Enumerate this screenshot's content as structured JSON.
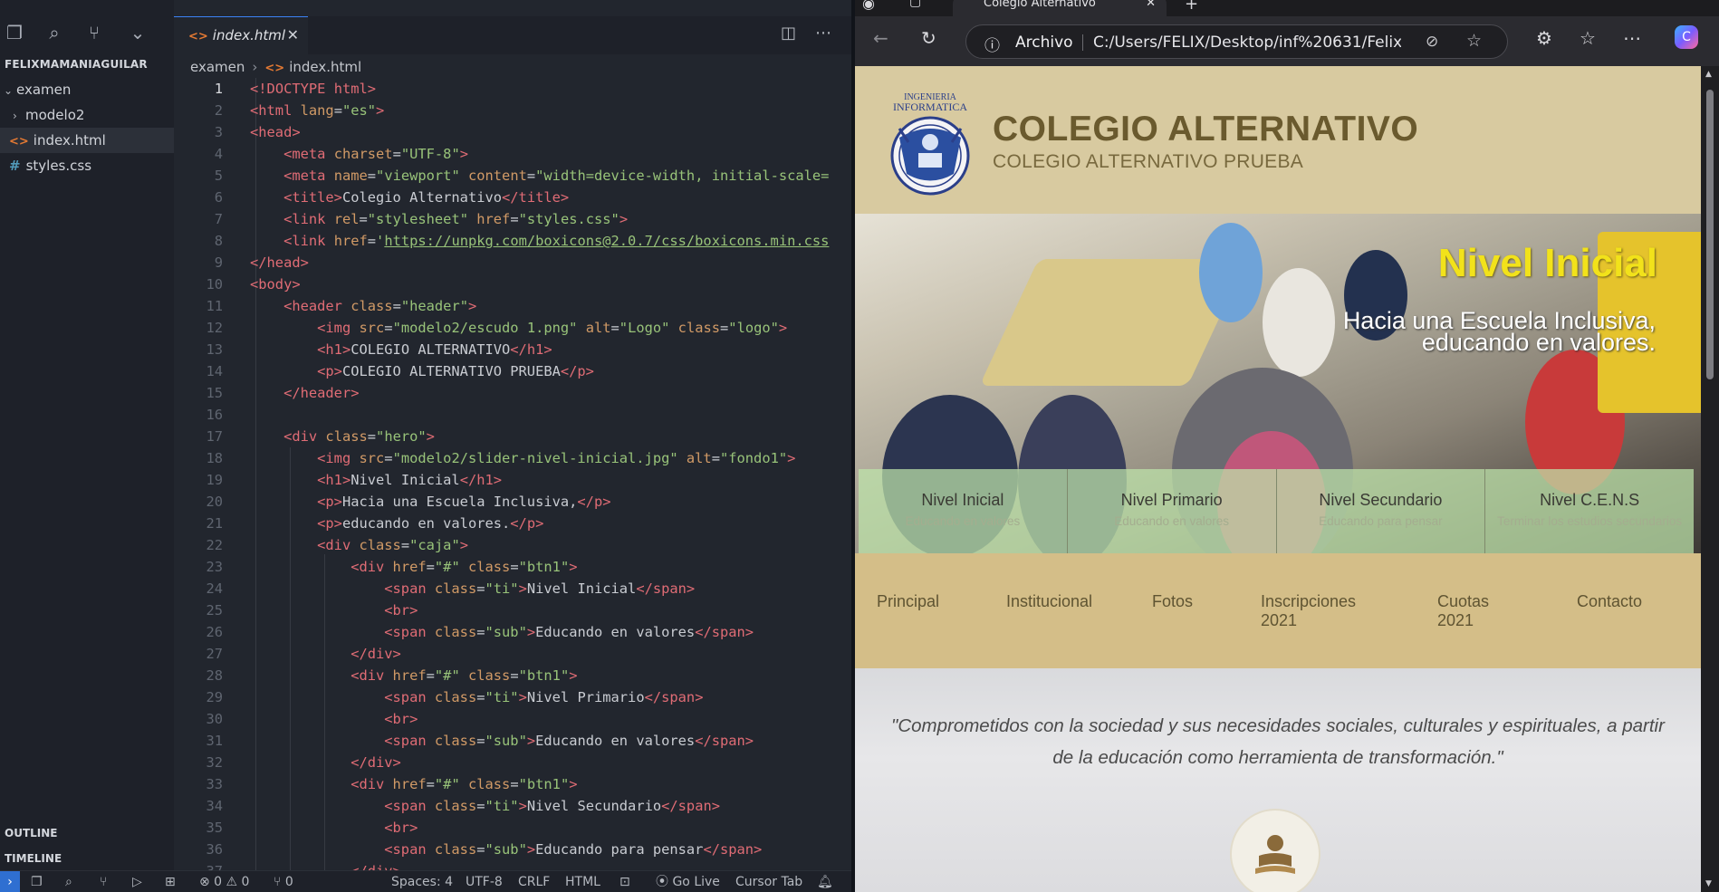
{
  "vscode": {
    "explorer": {
      "title": "FELIXMAMANIAGUILAR",
      "items": [
        {
          "label": "examen"
        },
        {
          "label": "modelo2"
        },
        {
          "label": "index.html"
        },
        {
          "label": "styles.css"
        }
      ],
      "outline_label": "OUTLINE",
      "timeline_label": "TIMELINE"
    },
    "tab": {
      "label": "index.html",
      "close": "✕"
    },
    "breadcrumb": {
      "folder": "examen",
      "file": "index.html"
    },
    "code_lines": [
      "1",
      "2",
      "3",
      "4",
      "5",
      "6",
      "7",
      "8",
      "9",
      "10",
      "11",
      "12",
      "13",
      "14",
      "15",
      "16",
      "17",
      "18",
      "19",
      "20",
      "21",
      "22",
      "23",
      "24",
      "25",
      "26",
      "27",
      "28",
      "29",
      "30",
      "31",
      "32",
      "33",
      "34",
      "35",
      "36",
      "37"
    ],
    "code": {
      "l1a": "<!",
      "l1b": "DOCTYPE",
      "l1c": " html",
      "l1d": ">",
      "l2a": "<html ",
      "l2b": "lang",
      "l2c": "=",
      "l2d": "\"es\"",
      "l2e": ">",
      "l3": "<head>",
      "l4a": "<meta ",
      "l4b": "charset",
      "l4c": "=",
      "l4d": "\"UTF-8\"",
      "l4e": ">",
      "l5a": "<meta ",
      "l5b": "name",
      "l5c": "=",
      "l5d": "\"viewport\"",
      "l5e": " content",
      "l5f": "=",
      "l5g": "\"width=device-width, initial-scale=",
      "l6a": "<title>",
      "l6b": "Colegio Alternativo",
      "l6c": "</title>",
      "l7a": "<link ",
      "l7b": "rel",
      "l7c": "=",
      "l7d": "\"stylesheet\"",
      "l7e": " href",
      "l7f": "=",
      "l7g": "\"styles.css\"",
      "l7h": ">",
      "l8a": "<link ",
      "l8b": "href",
      "l8c": "=",
      "l8d": "'",
      "l8e": "https://unpkg.com/boxicons@2.0.7/css/boxicons.min.css",
      "l9": "</head>",
      "l10": "<body>",
      "l11a": "<header ",
      "l11b": "class",
      "l11c": "=",
      "l11d": "\"header\"",
      "l11e": ">",
      "l12a": "<img ",
      "l12b": "src",
      "l12c": "=",
      "l12d": "\"modelo2/escudo 1.png\"",
      "l12e": " alt",
      "l12f": "=",
      "l12g": "\"Logo\"",
      "l12h": " class",
      "l12i": "=",
      "l12j": "\"logo\"",
      "l12k": ">",
      "l13a": "<h1>",
      "l13b": "COLEGIO ALTERNATIVO",
      "l13c": "</h1>",
      "l14a": "<p>",
      "l14b": "COLEGIO ALTERNATIVO PRUEBA",
      "l14c": "</p>",
      "l15": "</header>",
      "l17a": "<div ",
      "l17b": "class",
      "l17c": "=",
      "l17d": "\"hero\"",
      "l17e": ">",
      "l18a": "<img ",
      "l18b": "src",
      "l18c": "=",
      "l18d": "\"modelo2/slider-nivel-inicial.jpg\"",
      "l18e": " alt",
      "l18f": "=",
      "l18g": "\"fondo1\"",
      "l18h": ">",
      "l19a": "<h1>",
      "l19b": "Nivel Inicial",
      "l19c": "</h1>",
      "l20a": "<p>",
      "l20b": "Hacia una Escuela Inclusiva,",
      "l20c": "</p>",
      "l21a": "<p>",
      "l21b": "educando en valores.",
      "l21c": "</p>",
      "l22a": "<div ",
      "l22b": "class",
      "l22c": "=",
      "l22d": "\"caja\"",
      "l22e": ">",
      "div_btn_a": "<div ",
      "div_btn_b": "href",
      "div_btn_c": "=",
      "div_btn_d": "\"#\"",
      "div_btn_e": " class",
      "div_btn_f": "=",
      "div_btn_g": "\"btn1\"",
      "div_btn_h": ">",
      "span_a": "<span ",
      "span_b": "class",
      "span_c": "=",
      "span_ti": "\"ti\"",
      "span_sub": "\"sub\"",
      "span_d": ">",
      "span_e": "</span>",
      "l24": "Nivel Inicial",
      "br": "<br>",
      "l26": "Educando en valores",
      "div_close": "</div>",
      "l29": "Nivel Primario",
      "l31": "Educando en valores",
      "l34": "Nivel Secundario",
      "l36": "Educando para pensar"
    },
    "status": {
      "errors": "⊗ 0 ⚠ 0",
      "ports": "⑂ 0",
      "spaces": "Spaces: 4",
      "encoding": "UTF-8",
      "eol": "CRLF",
      "language": "HTML",
      "golive": "Go Live",
      "cursor_tab": "Cursor Tab"
    }
  },
  "browser": {
    "tab_title": "Colegio Alternativo",
    "address_label": "Archivo",
    "url": "C:/Users/FELIX/Desktop/inf%20631/FelixM...",
    "site": {
      "logo_text_top": "INGENIERIA",
      "logo_text_bottom": "INFORMATICA",
      "title": "COLEGIO ALTERNATIVO",
      "subtitle": "COLEGIO ALTERNATIVO PRUEBA",
      "hero_title": "Nivel Inicial",
      "hero_p1": "Hacia una Escuela Inclusiva,",
      "hero_p2": "educando en valores.",
      "levels": [
        {
          "title": "Nivel Inicial",
          "sub": "Educando en valores"
        },
        {
          "title": "Nivel Primario",
          "sub": "Educando en valores"
        },
        {
          "title": "Nivel Secundario",
          "sub": "Educando para pensar"
        },
        {
          "title": "Nivel C.E.N.S",
          "sub": "Terminar los estudios secundarios"
        }
      ],
      "menu": [
        {
          "label": "Principal"
        },
        {
          "label": "Institucional"
        },
        {
          "label": "Fotos"
        },
        {
          "label": "Inscripciones 2021"
        },
        {
          "label": "Cuotas 2021"
        },
        {
          "label": "Contacto"
        }
      ],
      "quote": "\"Comprometidos con la sociedad y sus necesidades sociales, culturales y espirituales, a partir de la educación como herramienta de transformación.\""
    }
  },
  "colors": {
    "vscode_bg": "#22262e",
    "sidebar_bg": "#1e2129",
    "tag": "#e06c75",
    "attr": "#d19a66",
    "string": "#98c379",
    "header_bg": "#d8caa0",
    "menu_bg": "#d4be88",
    "hero_title": "#f2e21a"
  }
}
